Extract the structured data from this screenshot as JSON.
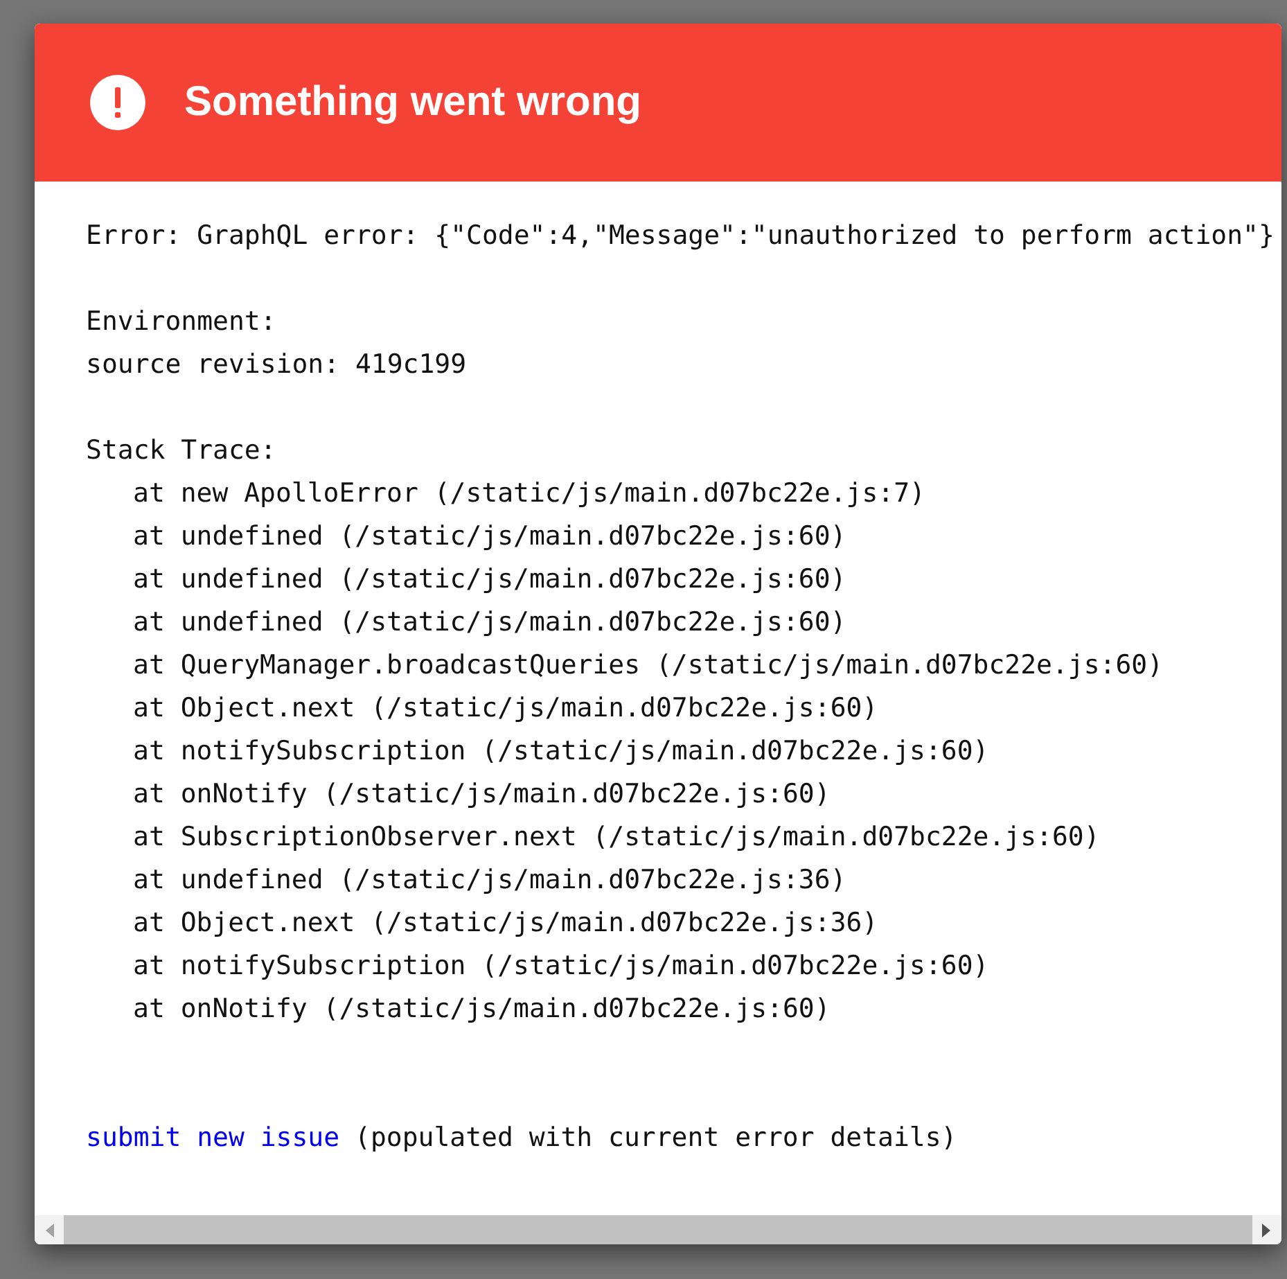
{
  "dialog": {
    "title": "Something went wrong",
    "error_line": "Error: GraphQL error: {\"Code\":4,\"Message\":\"unauthorized to perform action\"}",
    "environment_heading": "Environment:",
    "source_revision": "source revision: 419c199",
    "stack_heading": "Stack Trace:",
    "stack_frames": [
      "at new ApolloError (/static/js/main.d07bc22e.js:7)",
      "at undefined (/static/js/main.d07bc22e.js:60)",
      "at undefined (/static/js/main.d07bc22e.js:60)",
      "at undefined (/static/js/main.d07bc22e.js:60)",
      "at QueryManager.broadcastQueries (/static/js/main.d07bc22e.js:60)",
      "at Object.next (/static/js/main.d07bc22e.js:60)",
      "at notifySubscription (/static/js/main.d07bc22e.js:60)",
      "at onNotify (/static/js/main.d07bc22e.js:60)",
      "at SubscriptionObserver.next (/static/js/main.d07bc22e.js:60)",
      "at undefined (/static/js/main.d07bc22e.js:36)",
      "at Object.next (/static/js/main.d07bc22e.js:36)",
      "at notifySubscription (/static/js/main.d07bc22e.js:60)",
      "at onNotify (/static/js/main.d07bc22e.js:60)"
    ],
    "issue_link": "submit new issue",
    "issue_note": "(populated with current error details)"
  }
}
